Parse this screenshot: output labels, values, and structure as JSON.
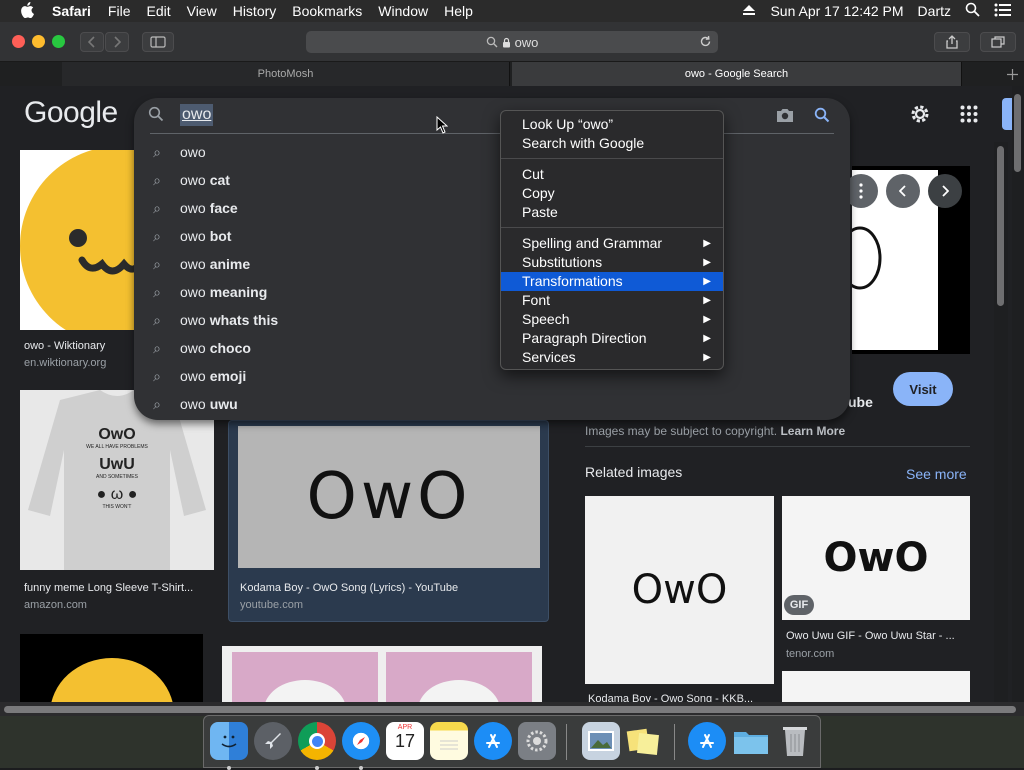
{
  "menubar": {
    "app": "Safari",
    "items": [
      "File",
      "Edit",
      "View",
      "History",
      "Bookmarks",
      "Window",
      "Help"
    ],
    "datetime": "Sun Apr 17  12:42 PM",
    "user": "Dartz"
  },
  "toolbar": {
    "url": "owo"
  },
  "tabs": [
    {
      "label": "PhotoMosh"
    },
    {
      "label": "owo - Google Search"
    }
  ],
  "google": {
    "logo": "Google",
    "query": "owo"
  },
  "suggestions": [
    {
      "prefix": "owo",
      "suffix": ""
    },
    {
      "prefix": "owo",
      "suffix": "cat"
    },
    {
      "prefix": "owo",
      "suffix": "face"
    },
    {
      "prefix": "owo",
      "suffix": "bot"
    },
    {
      "prefix": "owo",
      "suffix": "anime"
    },
    {
      "prefix": "owo",
      "suffix": "meaning"
    },
    {
      "prefix": "owo",
      "suffix": "whats this"
    },
    {
      "prefix": "owo",
      "suffix": "choco"
    },
    {
      "prefix": "owo",
      "suffix": "emoji"
    },
    {
      "prefix": "owo",
      "suffix": "uwu"
    }
  ],
  "results": [
    {
      "title": "owo - Wiktionary",
      "source": "en.wiktionary.org"
    },
    {
      "title": "funny meme Long Sleeve T-Shirt...",
      "source": "amazon.com"
    },
    {
      "title": "Kodama Boy - OwO Song (Lyrics) - YouTube",
      "source": "youtube.com"
    }
  ],
  "image_texts": {
    "owo_big": "OwO",
    "shirt_line1": "OwO",
    "shirt_line2": "WE ALL HAVE PROBLEMS",
    "shirt_line3": "UwU",
    "shirt_line4": "AND SOMETIMES",
    "shirt_line5": "THIS WON'T",
    "related1": "OwO",
    "related2": "OwO"
  },
  "panel": {
    "title_fragment": "ube",
    "visit": "Visit",
    "copyright": "Images may be subject to copyright.",
    "learn_more": "Learn More",
    "related_heading": "Related images",
    "see_more": "See more",
    "gif_badge": "GIF",
    "related": [
      {
        "title": "Kodama Boy - Owo Song - KKB...",
        "source": ""
      },
      {
        "title": "Owo Uwu GIF - Owo Uwu Star - ...",
        "source": "tenor.com"
      }
    ]
  },
  "context_menu": {
    "groups": [
      [
        {
          "label": "Look Up “owo”"
        },
        {
          "label": "Search with Google"
        }
      ],
      [
        {
          "label": "Cut"
        },
        {
          "label": "Copy"
        },
        {
          "label": "Paste"
        }
      ],
      [
        {
          "label": "Spelling and Grammar",
          "submenu": true
        },
        {
          "label": "Substitutions",
          "submenu": true
        },
        {
          "label": "Transformations",
          "submenu": true,
          "highlighted": true
        },
        {
          "label": "Font",
          "submenu": true
        },
        {
          "label": "Speech",
          "submenu": true
        },
        {
          "label": "Paragraph Direction",
          "submenu": true
        },
        {
          "label": "Services",
          "submenu": true
        }
      ]
    ]
  },
  "dock": {
    "calendar_month": "APR",
    "calendar_day": "17"
  },
  "colors": {
    "accent_blue": "#8ab4f8",
    "menu_highlight": "#0f5ad6",
    "emoji_yellow": "#f4c030"
  }
}
